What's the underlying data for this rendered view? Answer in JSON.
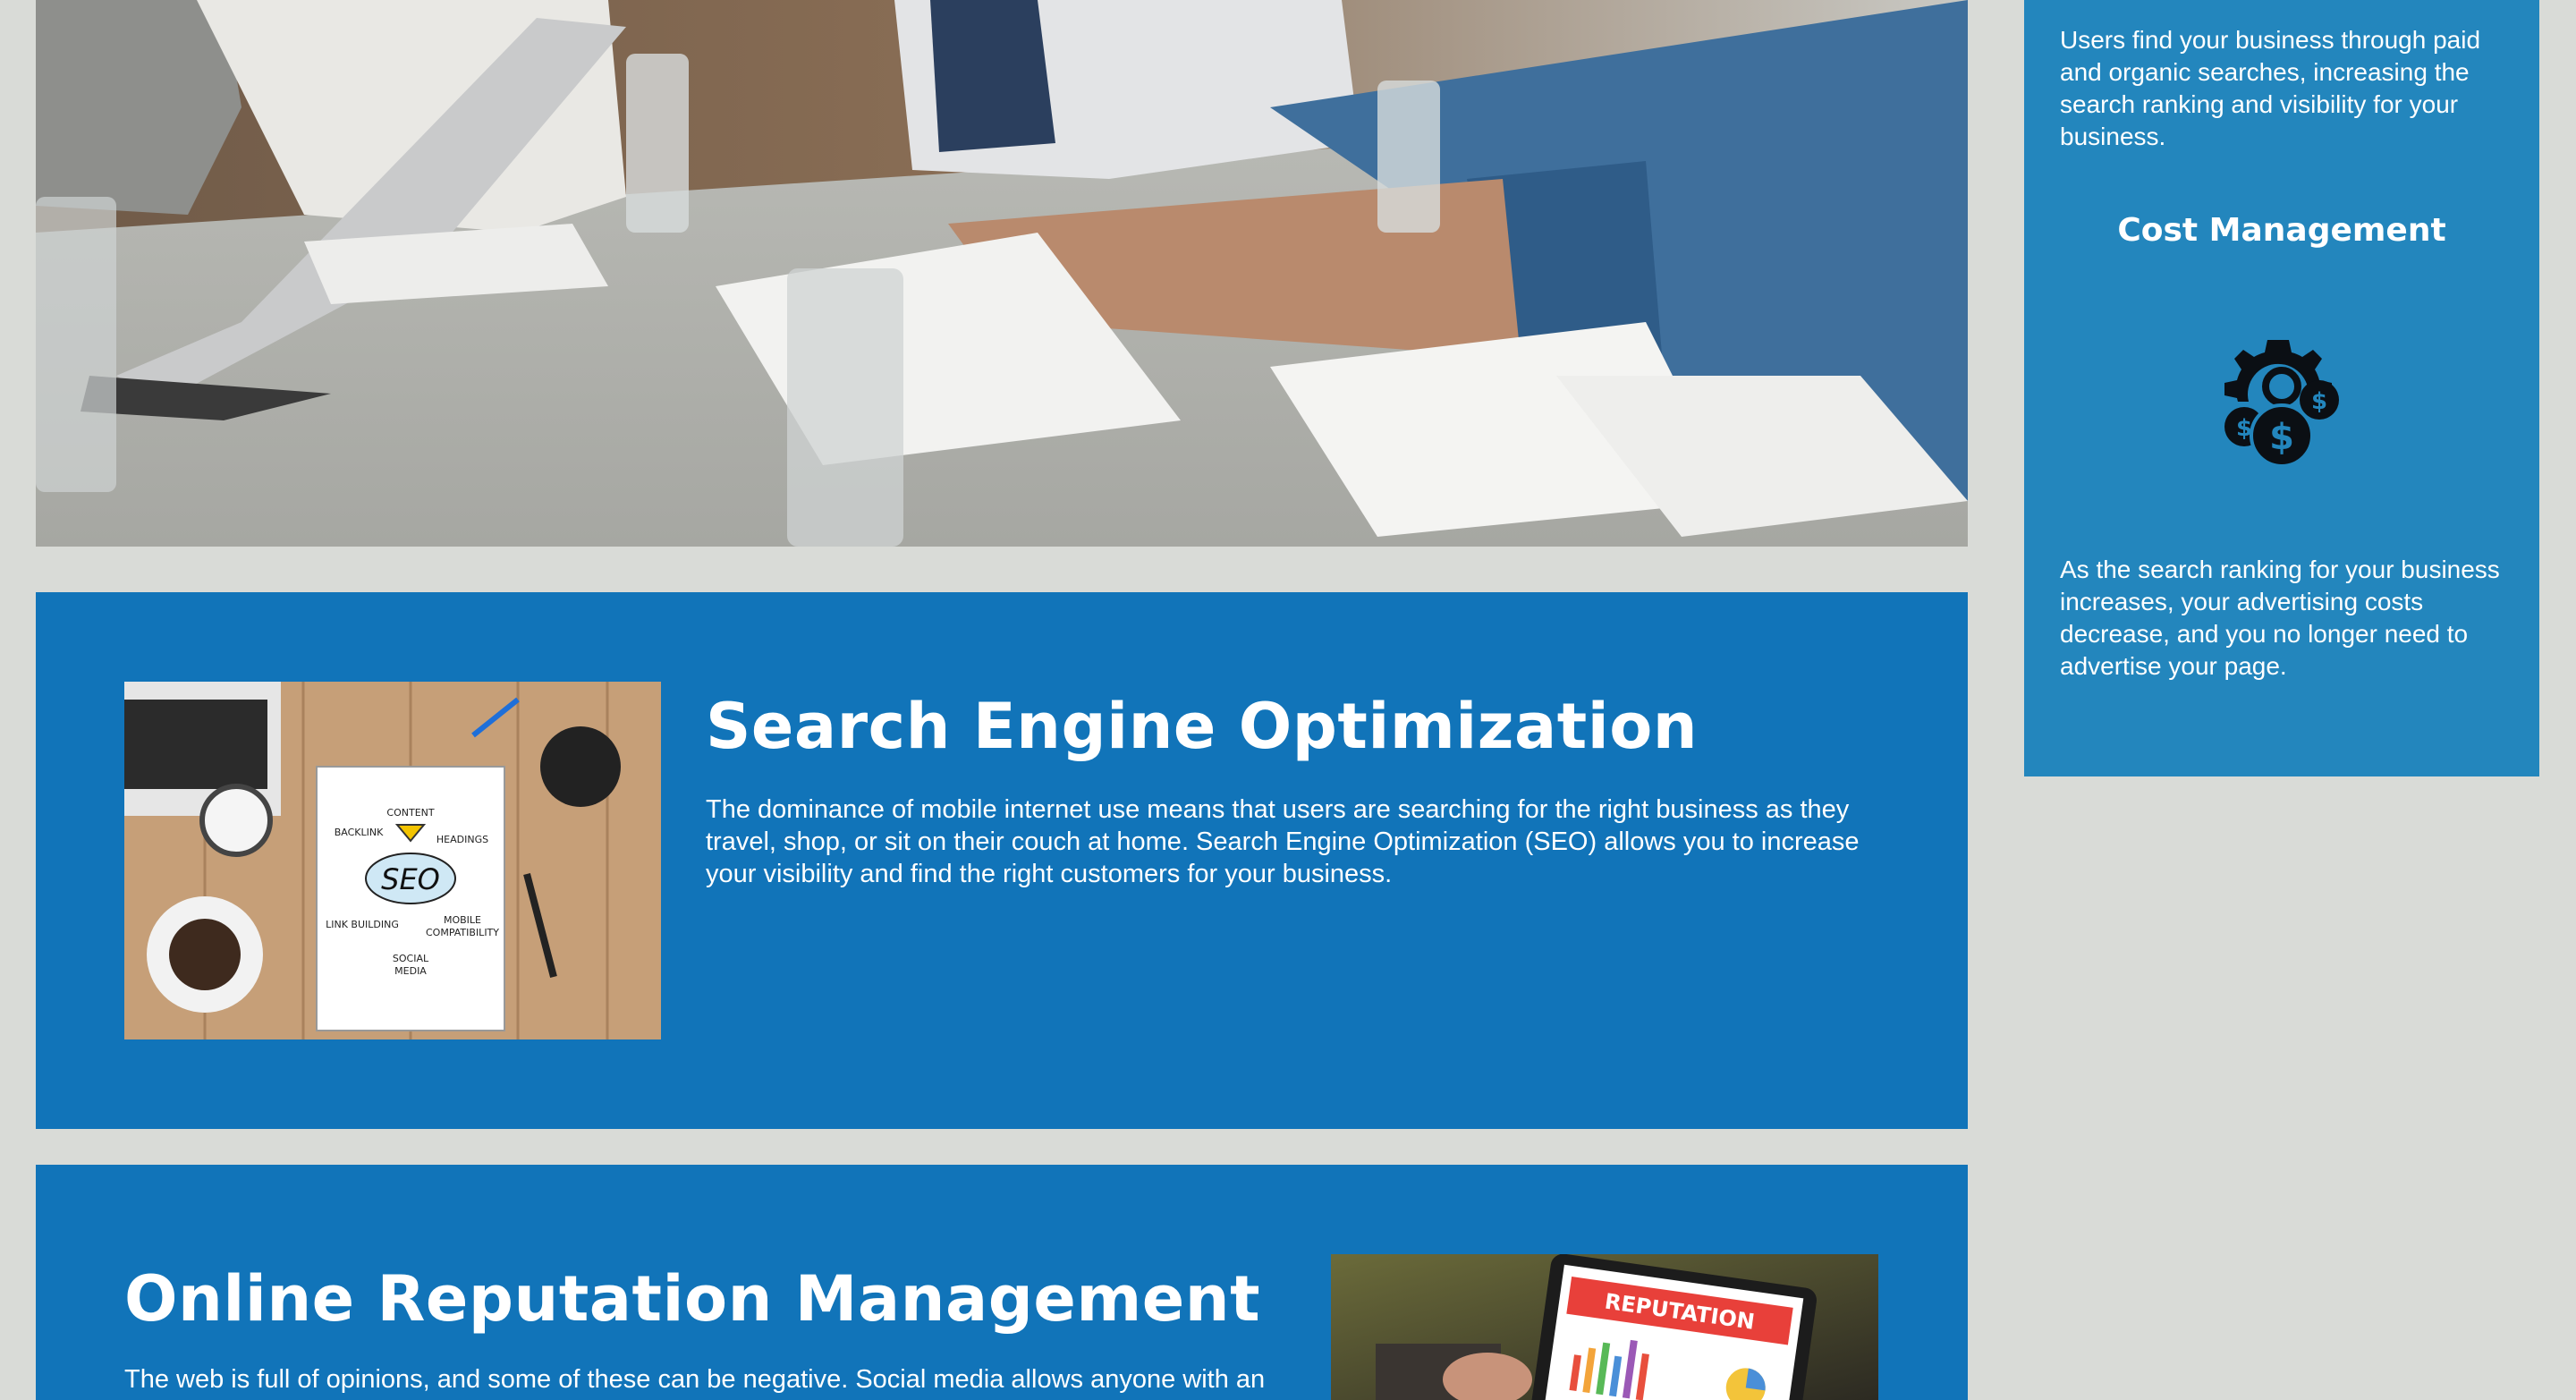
{
  "sidebar": {
    "intro_text": "Users find your business through paid and organic searches, increasing the search ranking and visibility for your business.",
    "cost_heading": "Cost Management",
    "cost_icon": "money-gear-icon",
    "cost_text": "As the search ranking for your business increases, your advertising costs decrease, and you no longer need to advertise your page."
  },
  "seo": {
    "heading": "Search Engine Optimization",
    "text": "The dominance of mobile internet use means that users are searching for the right business as they travel, shop, or sit on their couch at home. Search Engine Optimization (SEO) allows you to increase your visibility and find the right customers for your business.",
    "image_labels": {
      "content": "CONTENT",
      "backlink": "BACKLINK",
      "headings": "HEADINGS",
      "seo": "SEO",
      "link_building": "LINK BUILDING",
      "mobile": "MOBILE",
      "compatibility": "COMPATIBILITY",
      "social": "SOCIAL",
      "media": "MEDIA"
    }
  },
  "orm": {
    "heading": "Online Reputation Management",
    "text": "The web is full of opinions, and some of these can be negative. Social media allows anyone with an",
    "image_label": "REPUTATION"
  },
  "colors": {
    "page_background": "#d9dbd7",
    "section_blue": "#1174b9",
    "sidebar_blue": "#2386bd",
    "text": "#ffffff"
  }
}
